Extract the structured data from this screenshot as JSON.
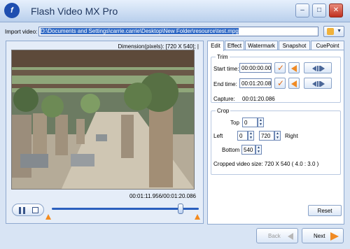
{
  "window": {
    "title": "Flash Video MX Pro",
    "minimize_glyph": "–",
    "maximize_glyph": "□",
    "close_glyph": "✕"
  },
  "import": {
    "label": "Import video:",
    "path": "D:\\Documents and Settings\\carrie.carrie\\Desktop\\New Folder\\resource\\test.mpg"
  },
  "preview": {
    "dimension": "Dimension(pixels): [720 X 540];  |",
    "timecode": "00:01:11.956/00:01:20.086",
    "slider_position": 0.88
  },
  "tabs": [
    "Edit",
    "Effect",
    "Watermark",
    "Snapshot",
    "CuePoint"
  ],
  "trim": {
    "title": "Trim",
    "start_label": "Start time:",
    "start_value": "00:00:00.000",
    "end_label": "End time:",
    "end_value": "00:01:20.086",
    "capture_label": "Capture:",
    "capture_value": "00:01:20.086"
  },
  "crop": {
    "title": "Crop",
    "top_label": "Top",
    "top_value": "0",
    "left_label": "Left",
    "left_value": "0",
    "right_label": "Right",
    "right_value": "720",
    "bottom_label": "Bottom",
    "bottom_value": "540",
    "cropped_size": "Cropped video size: 720 X 540  ( 4.0 : 3.0 )"
  },
  "buttons": {
    "reset": "Reset",
    "back": "Back",
    "next": "Next"
  },
  "colors": {
    "accent": "#f08a24",
    "selection": "#316ac5",
    "border": "#8fa9cf"
  }
}
